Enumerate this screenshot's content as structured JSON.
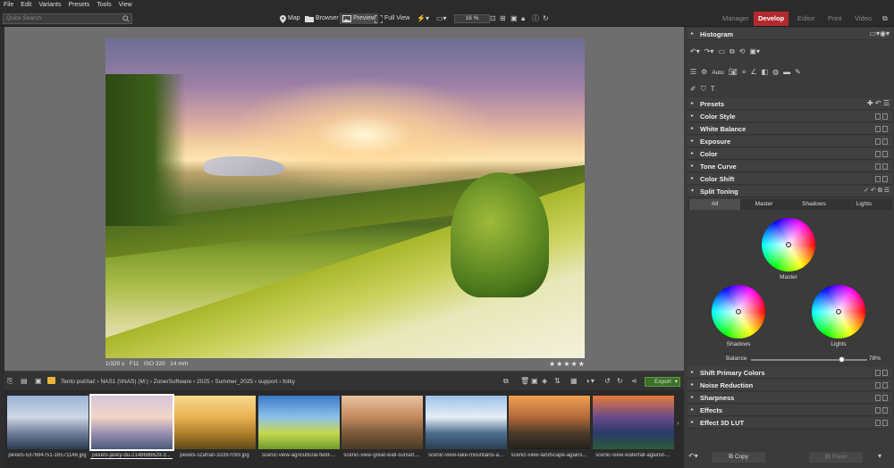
{
  "menu": [
    "File",
    "Edit",
    "Variants",
    "Presets",
    "Tools",
    "View"
  ],
  "search": {
    "placeholder": "Quick Search"
  },
  "toolbar": {
    "map": "Map",
    "browser": "Browser",
    "preview": "Preview",
    "full_view": "Full View",
    "zoom": "16 %"
  },
  "modules": [
    "Manager",
    "Develop",
    "Editor",
    "Print",
    "Video"
  ],
  "photo": {
    "exposure": "1/320 s",
    "aperture": "F11",
    "iso": "ISO 320",
    "focal": "14 mm",
    "stars": "★★★★★"
  },
  "path": [
    "Tento počítač",
    "NAS1 (\\\\NAS) (M:)",
    "ZonerSoftware",
    "2025",
    "Summer_2025",
    "support",
    "fotky"
  ],
  "export_label": "Export",
  "thumbs": [
    {
      "label": "pexels-537694751-16571146.jpg",
      "colors": [
        "#9bb3d6",
        "#cdd6e4",
        "#6f7f9a",
        "#2d3b52"
      ]
    },
    {
      "label": "pexels-javey-du-2148686629-3...",
      "colors": [
        "#d7c4d8",
        "#f3d6c8",
        "#9a8fb0",
        "#4a5a7a"
      ]
    },
    {
      "label": "pexels-szafran-33397093.jpg",
      "colors": [
        "#f6d98a",
        "#e9b254",
        "#b07f2a",
        "#5f4a1a"
      ]
    },
    {
      "label": "scenic-view-agricultural-field-...",
      "colors": [
        "#3a7ac8",
        "#8cc0ea",
        "#c6d84e",
        "#6d9a2a"
      ]
    },
    {
      "label": "scenic-view-great-wall-sunset....",
      "colors": [
        "#e8c2a0",
        "#c48a5e",
        "#7a5a3a",
        "#4a3a26"
      ]
    },
    {
      "label": "scenic-view-lake-mountains-a...",
      "colors": [
        "#9cc1e6",
        "#e6eef7",
        "#4c6e8e",
        "#2a3e52"
      ]
    },
    {
      "label": "scenic-view-landscape-agains...",
      "colors": [
        "#f0a050",
        "#b46a3a",
        "#4a3a2a",
        "#22201a"
      ]
    },
    {
      "label": "scenic-view-waterfall-against-...",
      "colors": [
        "#e87a3a",
        "#6a4a8a",
        "#2a3a6a",
        "#2e5a3a"
      ]
    }
  ],
  "panel": {
    "histogram": "Histogram",
    "auto": "Auto",
    "sections_top": [
      "Presets",
      "Color Style",
      "White Balance",
      "Exposure",
      "Color",
      "Tone Curve",
      "Color Shift"
    ],
    "split_toning": "Split Toning",
    "tabs": [
      "All",
      "Master",
      "Shadows",
      "Lights"
    ],
    "wheels": {
      "master": "Master",
      "shadows": "Shadows",
      "lights": "Lights"
    },
    "balance_label": "Balance",
    "balance_value": "78%",
    "balance_level": 0.78,
    "sections_bottom": [
      "Shift Primary Colors",
      "Noise Reduction",
      "Sharpness",
      "Effects",
      "Effect 3D LUT"
    ],
    "copy": "Copy",
    "paste": "Paste"
  }
}
